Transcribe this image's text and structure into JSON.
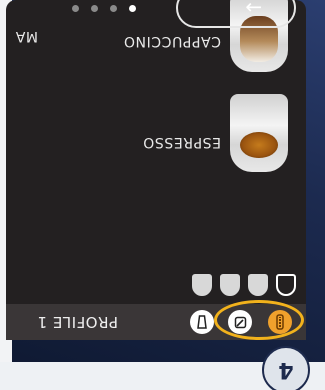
{
  "profile": {
    "label": "PROFILE 1",
    "icons": [
      "temperature-icon",
      "edit-icon",
      "cup-icon"
    ],
    "highlight_color": "#f2b21c"
  },
  "strength": {
    "levels": 4,
    "selected": 1
  },
  "drinks": [
    {
      "name": "ESPRESSO",
      "icon": "espresso-cup-icon"
    },
    {
      "name": "CAPPUCCINO",
      "icon": "cappuccino-cup-icon"
    },
    {
      "name": "MA",
      "icon": ""
    }
  ],
  "navigation": {
    "next_icon": "arrow-icon",
    "pages": 4,
    "active_page": 4
  },
  "step": {
    "number": "4"
  }
}
